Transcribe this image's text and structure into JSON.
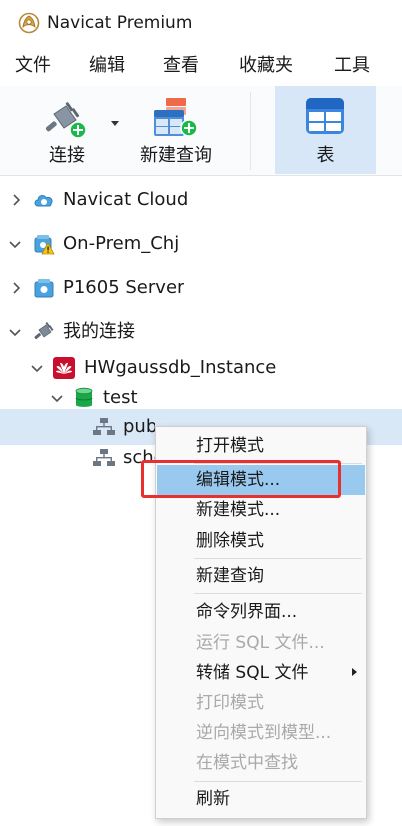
{
  "window": {
    "title": "Navicat Premium"
  },
  "menubar": {
    "items": [
      "文件",
      "编辑",
      "查看",
      "收藏夹",
      "工具"
    ]
  },
  "toolbar": {
    "connect_label": "连接",
    "new_query_label": "新建查询",
    "table_label": "表"
  },
  "tree": {
    "navicat_cloud": "Navicat Cloud",
    "on_prem": "On-Prem_Chj",
    "p1605_server": "P1605 Server",
    "my_connections": "我的连接",
    "instance": "HWgaussdb_Instance",
    "database": "test",
    "schema_public": "public",
    "schema_other": "sche"
  },
  "context_menu": {
    "items": [
      {
        "label": "打开模式",
        "disabled": false
      },
      {
        "label": "编辑模式...",
        "disabled": false,
        "hover": true
      },
      {
        "label": "新建模式...",
        "disabled": false
      },
      {
        "label": "删除模式",
        "disabled": false
      },
      {
        "label": "新建查询",
        "disabled": false
      },
      {
        "label": "命令列界面...",
        "disabled": false
      },
      {
        "label": "运行 SQL 文件...",
        "disabled": true
      },
      {
        "label": "转储 SQL 文件",
        "disabled": false,
        "submenu": true
      },
      {
        "label": "打印模式",
        "disabled": true
      },
      {
        "label": "逆向模式到模型...",
        "disabled": true
      },
      {
        "label": "在模式中查找",
        "disabled": true
      },
      {
        "label": "刷新",
        "disabled": false
      }
    ]
  },
  "colors": {
    "accent_hover": "#99c9ef",
    "selection": "#d9e8f6",
    "annotation_red": "#ea2f2f",
    "plus_green": "#1bb84c",
    "huawei_red": "#c8102e"
  }
}
